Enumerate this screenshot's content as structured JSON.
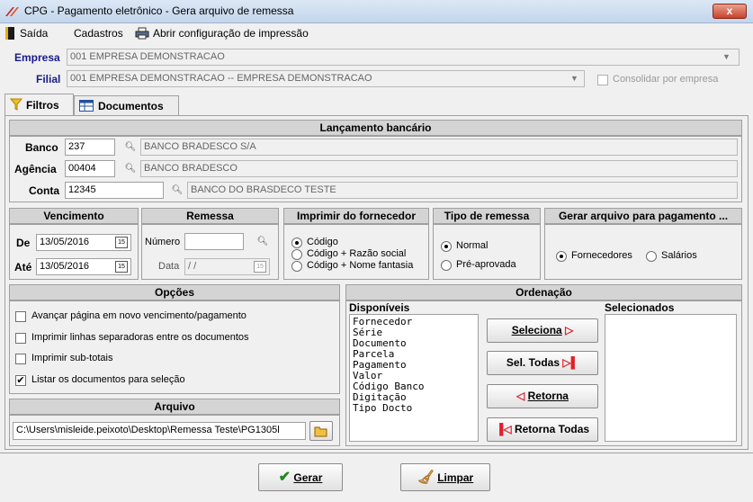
{
  "window": {
    "title": "CPG - Pagamento eletrônico - Gera arquivo de remessa",
    "close": "x"
  },
  "menu": {
    "exit": "Saída",
    "registers": "Cadastros",
    "print_config": "Abrir configuração de impressão"
  },
  "header": {
    "empresa_label": "Empresa",
    "empresa_value": "001 EMPRESA DEMONSTRACAO",
    "filial_label": "Filial",
    "filial_value": "001 EMPRESA DEMONSTRACAO -- EMPRESA DEMONSTRACAO",
    "consolidar_label": "Consolidar por empresa"
  },
  "tabs": [
    {
      "label": "Filtros"
    },
    {
      "label": "Documentos"
    }
  ],
  "lancamento": {
    "title": "Lançamento bancário",
    "banco_label": "Banco",
    "banco_code": "237",
    "banco_name": "BANCO BRADESCO S/A",
    "agencia_label": "Agência",
    "agencia_code": "00404",
    "agencia_name": "BANCO BRADESCO",
    "conta_label": "Conta",
    "conta_code": "12345",
    "conta_name": "BANCO DO BRASDECO TESTE"
  },
  "vencimento": {
    "title": "Vencimento",
    "de_label": "De",
    "de_value": "13/05/2016",
    "ate_label": "Até",
    "ate_value": "13/05/2016"
  },
  "remessa": {
    "title": "Remessa",
    "numero_label": "Número",
    "numero_value": "",
    "data_label": "Data",
    "data_value": " / /"
  },
  "imprimir": {
    "title": "Imprimir do fornecedor",
    "options": [
      "Código",
      "Código + Razão social",
      "Código + Nome fantasia"
    ],
    "selected": 0
  },
  "tipo_remessa": {
    "title": "Tipo de remessa",
    "options": [
      "Normal",
      "Pré-aprovada"
    ],
    "selected": 0
  },
  "gerar_para": {
    "title": "Gerar arquivo para pagamento ...",
    "options": [
      "Fornecedores",
      "Salários"
    ],
    "selected": 0
  },
  "opcoes": {
    "title": "Opções",
    "items": [
      {
        "label": "Avançar página em novo vencimento/pagamento",
        "checked": false
      },
      {
        "label": "Imprimir linhas separadoras entre os documentos",
        "checked": false
      },
      {
        "label": "Imprimir sub-totais",
        "checked": false
      },
      {
        "label": "Listar os documentos para seleção",
        "checked": true
      }
    ]
  },
  "arquivo": {
    "title": "Arquivo",
    "path": "C:\\Users\\misleide.peixoto\\Desktop\\Remessa Teste\\PG1305l"
  },
  "ordenacao": {
    "title": "Ordenação",
    "disponiveis_label": "Disponíveis",
    "selecionados_label": "Selecionados",
    "disponiveis": [
      "Fornecedor",
      "Série",
      "Documento",
      "Parcela",
      "Pagamento",
      "Valor",
      "Código Banco",
      "Digitação",
      "Tipo Docto"
    ],
    "btn_seleciona": "Seleciona",
    "btn_sel_todas": "Sel. Todas",
    "btn_retorna": "Retorna",
    "btn_retorna_todas": "Retorna Todas"
  },
  "footer": {
    "gerar": "Gerar",
    "limpar": "Limpar"
  },
  "colors": {
    "title_bar": "#c3d5ec",
    "panel_header": "#d4d4d4",
    "label_blue": "#1a1a8c",
    "arrow_red": "#e0202a",
    "check_green": "#1e8a1e"
  }
}
